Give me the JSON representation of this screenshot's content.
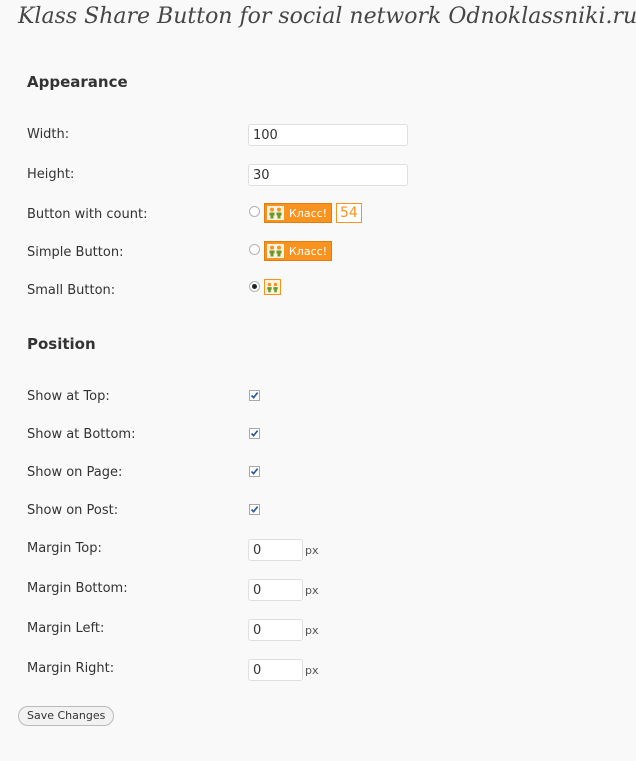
{
  "page_title": "Klass Share Button for social network Odnoklassniki.ru",
  "appearance": {
    "heading": "Appearance",
    "width": {
      "label": "Width:",
      "value": "100"
    },
    "height": {
      "label": "Height:",
      "value": "30"
    },
    "button_with_count": {
      "label": "Button with count:",
      "button_text": "Класс!",
      "count": "54",
      "selected": false
    },
    "simple_button": {
      "label": "Simple Button:",
      "button_text": "Класс!",
      "selected": false
    },
    "small_button": {
      "label": "Small Button:",
      "selected": true
    },
    "brand_color": "#f7931e",
    "logo_icon": "odnoklassniki-logo-icon"
  },
  "position": {
    "heading": "Position",
    "show_at_top": {
      "label": "Show at Top:",
      "checked": true
    },
    "show_at_bottom": {
      "label": "Show at Bottom:",
      "checked": true
    },
    "show_on_page": {
      "label": "Show on Page:",
      "checked": true
    },
    "show_on_post": {
      "label": "Show on Post:",
      "checked": true
    },
    "margin_top": {
      "label": "Margin Top:",
      "value": "0",
      "unit": "px"
    },
    "margin_bottom": {
      "label": "Margin Bottom:",
      "value": "0",
      "unit": "px"
    },
    "margin_left": {
      "label": "Margin Left:",
      "value": "0",
      "unit": "px"
    },
    "margin_right": {
      "label": "Margin Right:",
      "value": "0",
      "unit": "px"
    }
  },
  "save_label": "Save Changes"
}
